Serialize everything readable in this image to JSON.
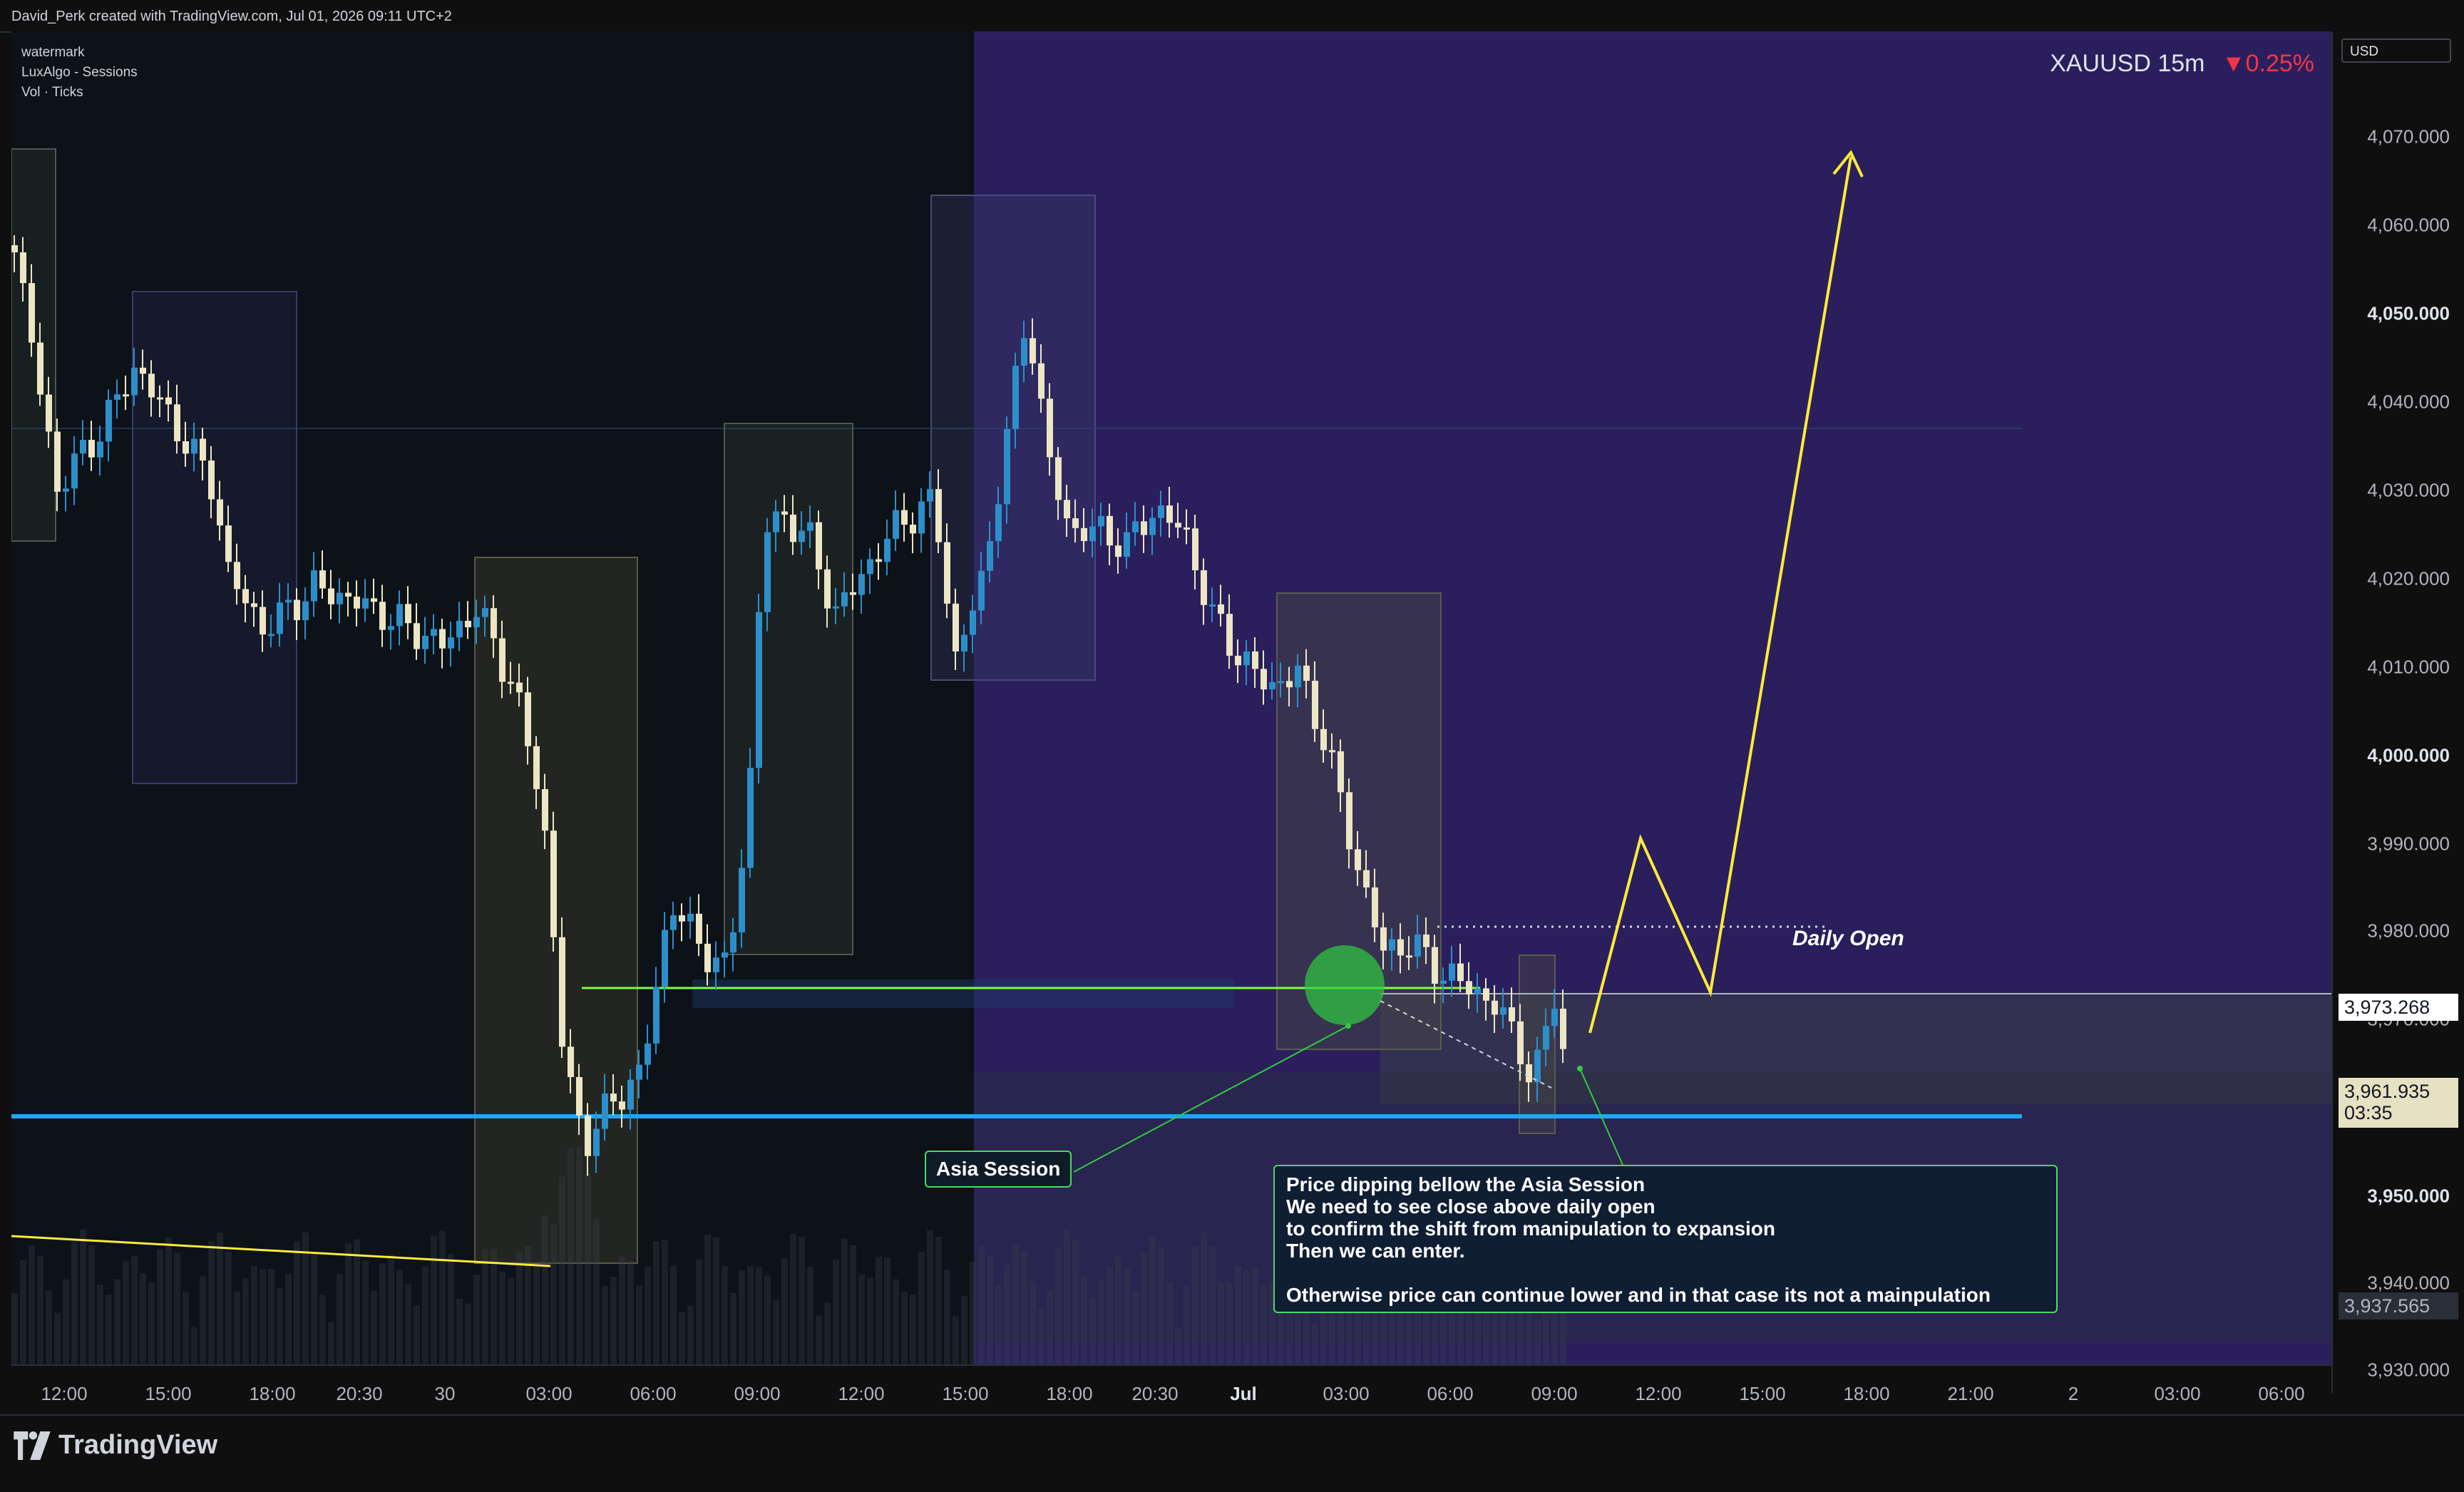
{
  "header": {
    "credit": "David_Perk created with TradingView.com, Jul 01, 2026 09:11 UTC+2"
  },
  "legend": {
    "line1": "watermark",
    "line2": "LuxAlgo - Sessions",
    "line3": "Vol · Ticks"
  },
  "symbol": {
    "ticker": "XAUUSD",
    "interval": "15m",
    "change": "▼0.25%"
  },
  "price_axis": {
    "currency": "USD",
    "labels": [
      "4,070.000",
      "4,060.000",
      "4,050.000",
      "4,040.000",
      "4,030.000",
      "4,020.000",
      "4,010.000",
      "4,000.000",
      "3,990.000",
      "3,980.000",
      "3,970.000",
      "3,950.000",
      "3,940.000",
      "3,930.000"
    ],
    "bold_labels": [
      "4,050.000",
      "4,000.000",
      "3,950.000"
    ],
    "tag_top": "3,973.268",
    "tag_current": "3,961.935",
    "tag_countdown": "03:35",
    "tag_bottom": "3,937.565"
  },
  "time_axis": {
    "labels": [
      "12:00",
      "15:00",
      "18:00",
      "20:30",
      "30",
      "03:00",
      "06:00",
      "09:00",
      "12:00",
      "15:00",
      "18:00",
      "20:30",
      "Jul",
      "03:00",
      "06:00",
      "09:00",
      "12:00",
      "15:00",
      "18:00",
      "21:00",
      "2",
      "03:00",
      "06:00"
    ],
    "bold_labels": [
      "Jul"
    ]
  },
  "annotations": {
    "asia_session": "Asia Session",
    "daily_open": "Daily Open",
    "note_lines": [
      "Price dipping bellow the Asia Session",
      "We need to see close above daily open",
      "to confirm the shift from manipulation to expansion",
      "Then we can enter.",
      "",
      "Otherwise price can continue lower and in that case its not a mainpulation"
    ]
  },
  "footer": {
    "brand": "TradingView"
  },
  "colors": {
    "up": "#2d8fc9",
    "down": "#ede6c4",
    "session_purple": "#2a1f5c",
    "level_blue": "#1ea7fd",
    "level_green": "#7cff3a",
    "projection": "#ffeb3b",
    "accent_red": "#f23645"
  }
}
